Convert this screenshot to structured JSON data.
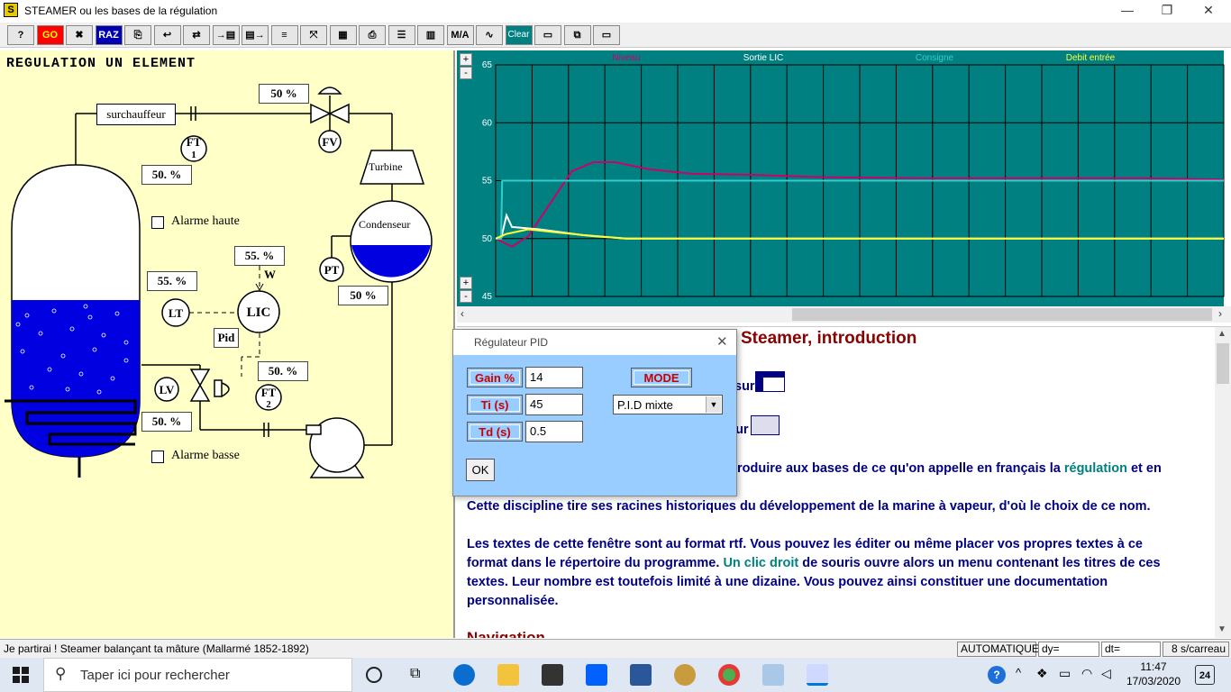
{
  "window": {
    "title": "STEAMER ou les bases de la régulation",
    "controls": [
      "—",
      "❐",
      "✕"
    ]
  },
  "toolbar": {
    "buttons": [
      {
        "name": "help-button",
        "label": "?"
      },
      {
        "name": "go-button",
        "label": "GO",
        "color": "#ff0000"
      },
      {
        "name": "stop-button",
        "label": "✖"
      },
      {
        "name": "raz-button",
        "label": "RAZ"
      },
      {
        "name": "tool-4-button",
        "label": "⎘"
      },
      {
        "name": "tool-5-button",
        "label": "↩"
      },
      {
        "name": "tool-6-button",
        "label": "⇄"
      },
      {
        "name": "save-button",
        "label": "→▤"
      },
      {
        "name": "export-button",
        "label": "▤→"
      },
      {
        "name": "colors-button",
        "label": "≡"
      },
      {
        "name": "scale-button",
        "label": "⤧"
      },
      {
        "name": "grid-button",
        "label": "▦"
      },
      {
        "name": "print-button",
        "label": "⎙"
      },
      {
        "name": "lines-button",
        "label": "☰"
      },
      {
        "name": "columns-button",
        "label": "▥"
      },
      {
        "name": "ma-button",
        "label": "M/A"
      },
      {
        "name": "wave-button",
        "label": "∿"
      },
      {
        "name": "clear-button",
        "label": "Clear"
      },
      {
        "name": "panel-button",
        "label": "▭"
      },
      {
        "name": "pid-window-button",
        "label": "⧉"
      },
      {
        "name": "doc-window-button",
        "label": "▭"
      }
    ]
  },
  "schematic": {
    "title": "REGULATION UN ELEMENT",
    "values": {
      "valve_top": "50 %",
      "ft1_flow": "50. %",
      "setpoint": "55. %",
      "level": "55. %",
      "pid_out": "50. %",
      "drum_bottom": "50. %",
      "condenser": "50 %"
    },
    "labels": {
      "superheater": "surchauffeur",
      "turbine": "Turbine",
      "condenser": "Condenseur",
      "alarm_high": "Alarme haute",
      "alarm_low": "Alarme basse",
      "pid_button": "Pid",
      "w": "W",
      "ft1": "FT\n1",
      "fv": "FV",
      "pt": "PT",
      "lt": "LT",
      "lic": "LIC",
      "lv": "LV",
      "ft2": "FT\n2"
    }
  },
  "chart_data": {
    "type": "line",
    "series": [
      {
        "name": "Niveau",
        "color": "#cc0066",
        "values": [
          [
            0,
            50
          ],
          [
            1.5,
            49.3
          ],
          [
            3,
            50.2
          ],
          [
            5,
            53
          ],
          [
            7,
            55.8
          ],
          [
            9,
            56.6
          ],
          [
            11,
            56.6
          ],
          [
            14,
            56
          ],
          [
            18,
            55.6
          ],
          [
            24,
            55.5
          ],
          [
            30,
            55.3
          ],
          [
            40,
            55.2
          ],
          [
            50,
            55.2
          ],
          [
            60,
            55.2
          ],
          [
            67,
            55.1
          ]
        ]
      },
      {
        "name": "Sortie LIC",
        "color": "#ffffff",
        "values": [
          [
            0,
            50
          ],
          [
            0.5,
            50
          ],
          [
            1,
            52
          ],
          [
            1.5,
            51
          ],
          [
            4,
            50.8
          ],
          [
            8,
            50.3
          ],
          [
            12,
            50
          ],
          [
            20,
            50
          ],
          [
            67,
            50
          ]
        ]
      },
      {
        "name": "Consigne",
        "color": "#33cccc",
        "values": [
          [
            0,
            50
          ],
          [
            0.5,
            50
          ],
          [
            0.6,
            55
          ],
          [
            67,
            55
          ]
        ]
      },
      {
        "name": "Debit entrée",
        "color": "#ffff33",
        "values": [
          [
            0,
            50
          ],
          [
            1,
            50.4
          ],
          [
            3,
            50.8
          ],
          [
            6,
            50.5
          ],
          [
            9,
            50.2
          ],
          [
            12,
            50
          ],
          [
            67,
            50
          ]
        ]
      }
    ],
    "ylim": [
      45,
      65
    ],
    "yticks": [
      45,
      50,
      55,
      60,
      65
    ],
    "xlim": [
      0,
      67
    ],
    "grid": true,
    "legend": "top"
  },
  "document": {
    "heading": "Steamer, introduction",
    "line_sur1": "sur",
    "line_sur2": "sur",
    "p1_start": "roduire aux bases de ce qu'on appelle en français la ",
    "p1_link": "régulation",
    "p1_end": " et en",
    "p2": "Cette discipline tire ses racines historiques du développement de la marine à vapeur, d'où le choix de ce nom.",
    "p3a": "Les textes de cette fenêtre sont au format rtf. Vous pouvez les éditer ou même placer vos propres textes à ce",
    "p3b_start": "format dans le répertoire du programme. ",
    "p3b_link": "Un clic droit",
    "p3b_end": " de souris ouvre alors un menu contenant les titres de ces",
    "p3c": "textes. Leur nombre est toutefois limité à une dizaine. Vous pouvez ainsi constituer une documentation",
    "p3d": "personnalisée.",
    "next_heading": "Navigation"
  },
  "dialog": {
    "title": "Régulateur PID",
    "close": "✕",
    "fields": [
      {
        "label": "Gain %",
        "value": "14"
      },
      {
        "label": "Ti (s)",
        "value": "45"
      },
      {
        "label": "Td (s)",
        "value": "0.5"
      }
    ],
    "mode_label": "MODE",
    "mode_value": "P.I.D mixte",
    "ok": "OK"
  },
  "status": {
    "message": "Je partirai ! Steamer balançant ta mâture  (Mallarmé 1852-1892)",
    "mode": "AUTOMATIQUE",
    "dy": "dy=",
    "dt": "dt=",
    "scale": "8 s/carreau"
  },
  "taskbar": {
    "search_placeholder": "Taper ici pour rechercher",
    "time": "11:47",
    "date": "17/03/2020",
    "notifications": "24"
  }
}
